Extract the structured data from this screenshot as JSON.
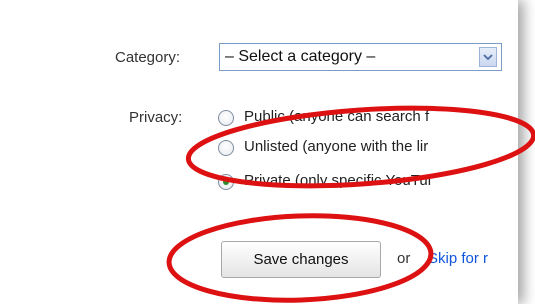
{
  "form": {
    "category_label": "Category:",
    "category_select": "– Select a category –",
    "privacy_label": "Privacy:",
    "privacy_options": [
      {
        "label": "Public (anyone can search f",
        "checked": false
      },
      {
        "label": "Unlisted (anyone with the lir",
        "checked": false
      },
      {
        "label": "Private (only specific YouTul",
        "checked": true
      }
    ],
    "save_button": "Save changes",
    "or_text": "or",
    "skip_link": "Skip for r"
  },
  "colors": {
    "annotation": "#dd1111",
    "link": "#1155dd",
    "radio_selected": "#2b8a2b"
  },
  "icons": {
    "select_arrow": "chevron-down-icon"
  }
}
